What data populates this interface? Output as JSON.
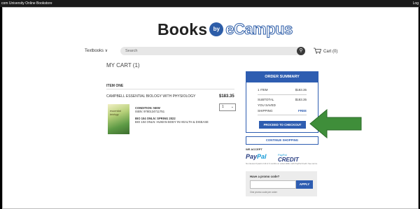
{
  "topbar": {
    "store_name": "com University Online Bookstore",
    "login": "Log"
  },
  "logo": {
    "books": "Books",
    "by": "by",
    "ecampus": "eCampus"
  },
  "nav": {
    "textbooks": "Textbooks ∨",
    "search_placeholder": "Search",
    "cart": "Cart (0)"
  },
  "cart": {
    "heading": "MY CART (1)",
    "item_label": "ITEM ONE",
    "item": {
      "title": "CAMPBELL ESSENTIAL BIOLOGY WITH PHYSIOLOGY",
      "price": "$183.35",
      "qty": "1",
      "cover_text": "essential biology",
      "condition": "CONDITION: NEW",
      "isbn": "ISBN: 9780134711751",
      "course": "BIO 104 ONLN: SPRING 2022",
      "course_desc": "BIO 104 ONLN: HUMAN BODY IN HEALTH & DISEASE"
    }
  },
  "summary": {
    "header": "ORDER SUMMARY",
    "items_label": "1 ITEM",
    "items_value": "$183.35",
    "subtotal_label": "SUBTOTAL",
    "subtotal_value": "$183.35",
    "saved_label": "YOU SAVED",
    "shipping_label": "SHIPPING",
    "shipping_value": "FREE",
    "checkout": "PROCEED TO CHECKOUT"
  },
  "continue_shopping": "CONTINUE SHOPPING",
  "payments": {
    "we_accept": "WE ACCEPT",
    "paypal_pay": "Pay",
    "paypal_pal": "Pal",
    "paypal_small": "PayPal",
    "credit": "CREDIT",
    "fine_print": "No interest if paid in full in 6 months on orders $99+ with PayPal Credit. See terms."
  },
  "promo": {
    "question": "Have a promo code?",
    "apply": "APPLY",
    "note": "One promo code per order"
  },
  "colors": {
    "accent": "#2e5db1",
    "arrow": "#3f8e3a"
  }
}
